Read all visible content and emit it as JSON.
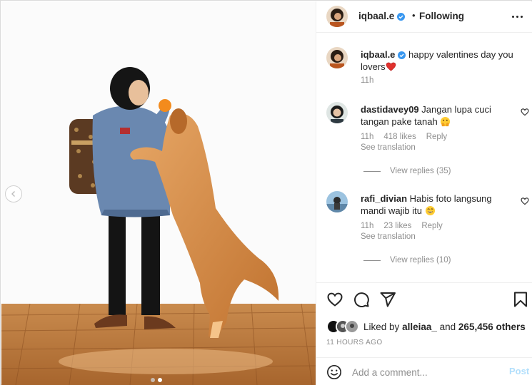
{
  "post": {
    "username": "iqbaal.e",
    "verified": true,
    "follow_status": "Following",
    "separator": "•"
  },
  "caption": {
    "username": "iqbaal.e",
    "text": "happy valentines day you lovers",
    "emoji": "heart-emoji",
    "age": "11h"
  },
  "comments": [
    {
      "username": "dastidavey09",
      "text": "Jangan lupa cuci tangan pake tanah",
      "emoji": "hands-over-mouth-emoji",
      "age": "11h",
      "likes": "418 likes",
      "reply_label": "Reply",
      "translation_label": "See translation",
      "view_replies": "View replies (35)"
    },
    {
      "username": "rafi_divian",
      "text": "Habis foto langsung mandi wajib itu",
      "emoji": "grinning-face-emoji",
      "age": "11h",
      "likes": "23 likes",
      "reply_label": "Reply",
      "translation_label": "See translation",
      "view_replies": "View replies (10)"
    }
  ],
  "likes": {
    "prefix": "Liked by",
    "user": "alleiaa_",
    "connector": "and",
    "others": "265,456 others"
  },
  "timestamp": "11 HOURS AGO",
  "comment_box": {
    "placeholder": "Add a comment...",
    "post_label": "Post"
  },
  "media": {
    "slide_count": 2,
    "active_slide": 2
  },
  "colors": {
    "text": "#262626",
    "muted": "#8e8e8e",
    "verified_blue": "#3897f0",
    "post_button_disabled": "#b2dffc",
    "heart_red": "#ed4956"
  },
  "icons": [
    "verified-badge-icon",
    "more-options-icon",
    "comment-heart-icon",
    "like-icon",
    "comment-icon",
    "share-icon",
    "save-icon",
    "emoji-icon",
    "chevron-left-icon"
  ]
}
